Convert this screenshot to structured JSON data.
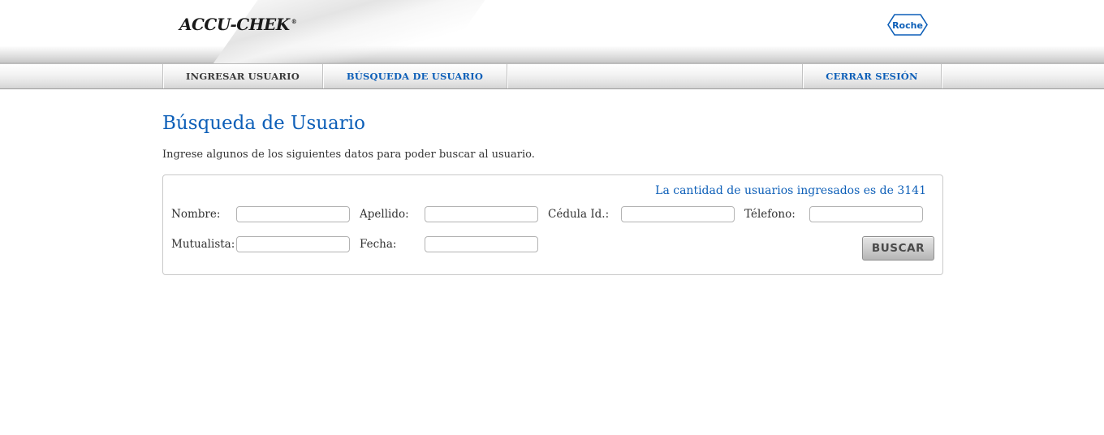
{
  "header": {
    "brand_logo_text": "ACCU-CHEK",
    "roche_logo_text": "Roche"
  },
  "nav": {
    "items": [
      {
        "label": "INGRESAR USUARIO",
        "active": false
      },
      {
        "label": "BÚSQUEDA DE USUARIO",
        "active": true
      },
      {
        "label": "CERRAR SESIÓN",
        "active": false
      }
    ]
  },
  "page": {
    "title": "Búsqueda de Usuario",
    "intro": "Ingrese algunos de los siguientes datos para poder buscar al usuario."
  },
  "search": {
    "user_count_text": "La cantidad de usuarios ingresados es de 3141",
    "fields": {
      "nombre": {
        "label": "Nombre:",
        "value": ""
      },
      "apellido": {
        "label": "Apellido:",
        "value": ""
      },
      "cedula": {
        "label": "Cédula Id.:",
        "value": ""
      },
      "telefono": {
        "label": "Télefono:",
        "value": ""
      },
      "mutualista": {
        "label": "Mutualista:",
        "value": ""
      },
      "fecha": {
        "label": "Fecha:",
        "value": ""
      }
    },
    "button_label": "BUSCAR"
  },
  "colors": {
    "accent_blue": "#0d5fb8",
    "text_dark": "#333333",
    "border_gray": "#c9c9c9"
  },
  "icons": {
    "roche_logo": "roche-hexagon-logo"
  }
}
